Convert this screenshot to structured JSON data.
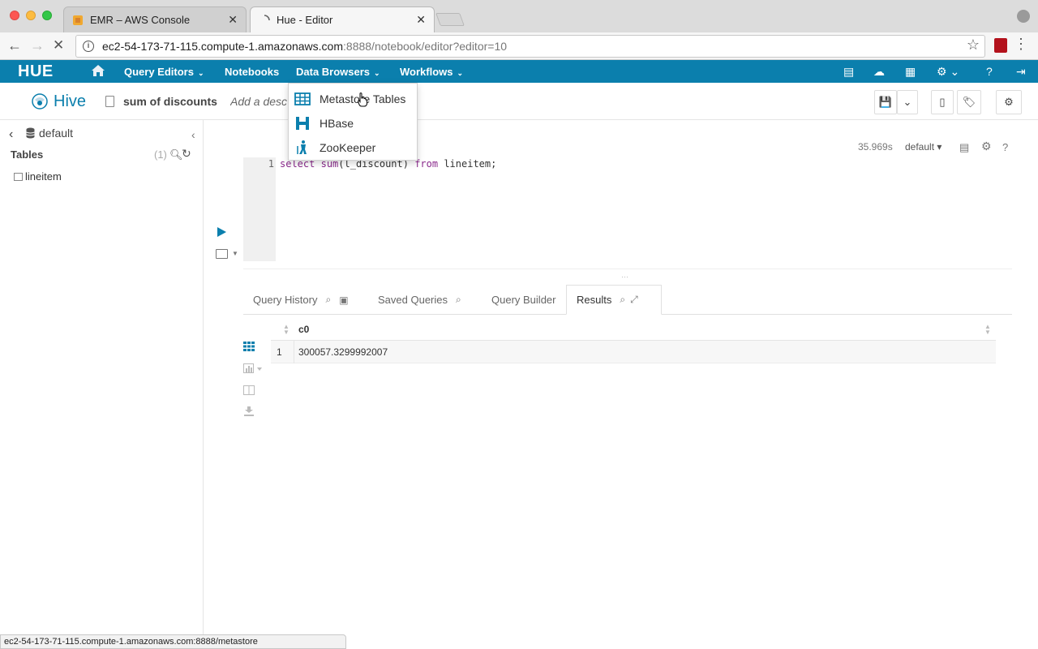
{
  "browser": {
    "tabs": [
      {
        "title": "EMR – AWS Console",
        "active": false
      },
      {
        "title": "Hue - Editor",
        "active": true
      }
    ],
    "url_host": "ec2-54-173-71-115.compute-1.amazonaws.com",
    "url_rest": ":8888/notebook/editor?editor=10",
    "status_url": "ec2-54-173-71-115.compute-1.amazonaws.com:8888/metastore"
  },
  "hue_nav": {
    "logo": "HUE",
    "items": [
      {
        "label": "Query Editors"
      },
      {
        "label": "Notebooks"
      },
      {
        "label": "Data Browsers"
      },
      {
        "label": "Workflows"
      }
    ]
  },
  "data_browsers_menu": {
    "items": [
      {
        "label": "Metastore Tables",
        "icon": "table-grid-icon"
      },
      {
        "label": "HBase",
        "icon": "hbase-icon"
      },
      {
        "label": "ZooKeeper",
        "icon": "zookeeper-icon"
      }
    ]
  },
  "editor_header": {
    "app_name": "Hive",
    "query_name": "sum of discounts",
    "description_placeholder": "Add a description..."
  },
  "left_panel": {
    "database": "default",
    "section_title": "Tables",
    "count": "(1)",
    "tables": [
      "lineitem"
    ]
  },
  "snippet": {
    "duration": "35.969s",
    "database_select": "default",
    "line_number": "1",
    "code": "select sum(l_discount) from lineitem;"
  },
  "result_tabs": [
    {
      "label": "Query History"
    },
    {
      "label": "Saved Queries"
    },
    {
      "label": "Query Builder"
    },
    {
      "label": "Results"
    }
  ],
  "results": {
    "columns": [
      "c0"
    ],
    "rows": [
      {
        "num": "1",
        "values": [
          "300057.3299992007"
        ]
      }
    ]
  },
  "colors": {
    "hue_blue": "#0b7fad",
    "nav_text": "#ffffff"
  }
}
